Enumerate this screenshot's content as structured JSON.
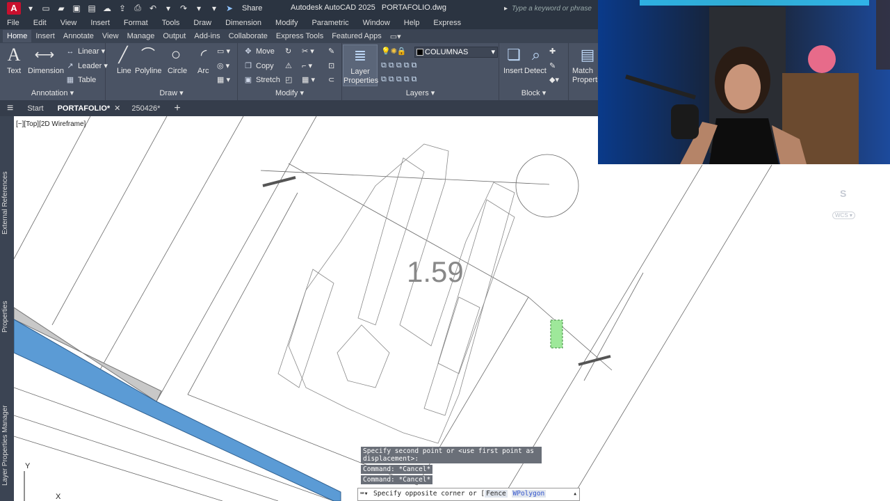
{
  "titlebar": {
    "app_title": "Autodesk AutoCAD 2025",
    "file_name": "PORTAFOLIO.dwg",
    "share_label": "Share",
    "search_placeholder": "Type a keyword or phrase",
    "logo_letter": "A"
  },
  "menu": [
    "File",
    "Edit",
    "View",
    "Insert",
    "Format",
    "Tools",
    "Draw",
    "Dimension",
    "Modify",
    "Parametric",
    "Window",
    "Help",
    "Express"
  ],
  "ribbon_tabs": [
    "Home",
    "Insert",
    "Annotate",
    "View",
    "Manage",
    "Output",
    "Add-ins",
    "Collaborate",
    "Express Tools",
    "Featured Apps"
  ],
  "ribbon_active_tab": "Home",
  "ribbon": {
    "annotation": {
      "title": "Annotation",
      "text": "Text",
      "dimension": "Dimension",
      "linear": "Linear",
      "leader": "Leader",
      "table": "Table"
    },
    "draw": {
      "title": "Draw",
      "line": "Line",
      "polyline": "Polyline",
      "circle": "Circle",
      "arc": "Arc"
    },
    "modify": {
      "title": "Modify",
      "move": "Move",
      "copy": "Copy",
      "stretch": "Stretch"
    },
    "layers": {
      "title": "Layers",
      "layer_properties": "Layer Properties",
      "current_layer": "COLUMNAS",
      "current_layer_color": "#000000"
    },
    "block": {
      "title": "Block",
      "insert": "Insert",
      "detect": "Detect"
    },
    "match": {
      "label": "Match Properties"
    }
  },
  "doc_tabs": {
    "menu_icon": "hamburger-icon",
    "start": "Start",
    "active": "PORTAFOLIO*",
    "other": "250426*",
    "add": "+"
  },
  "viewport": {
    "label": "[−][Top][2D Wireframe]",
    "dimension_text": "1.59",
    "viewcube_south": "S",
    "wcs_label": "WCS",
    "ucs_y": "Y",
    "ucs_x": "X"
  },
  "side_palettes": [
    "External References",
    "Properties",
    "Layer Properties Manager"
  ],
  "command": {
    "history": [
      "Specify second point or <use first point as",
      "displacement>:",
      "Command: *Cancel*",
      "Command: *Cancel*"
    ],
    "prompt_prefix": "Specify opposite corner or [",
    "options": [
      "Fence",
      "WPolygon"
    ]
  },
  "colors": {
    "accent": "#5b9bd5",
    "selection_green": "#9ee89a",
    "title_bg": "#2b3441",
    "ribbon_bg": "#4a5364"
  }
}
